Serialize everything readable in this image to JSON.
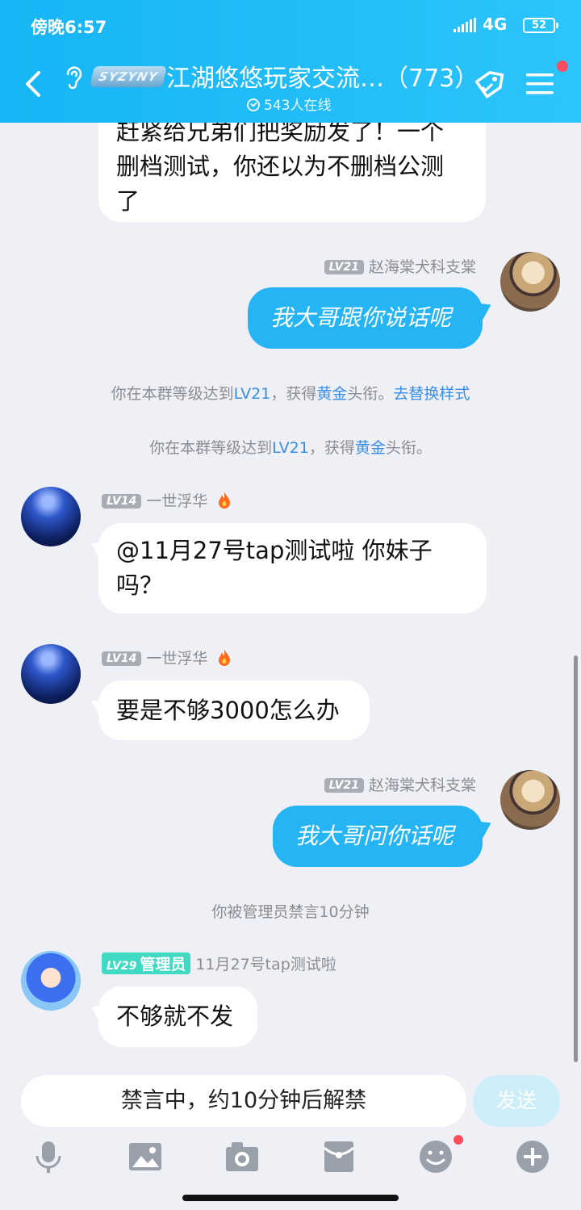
{
  "status_bar": {
    "time": "傍晚6:57",
    "network": "4G",
    "battery": "52"
  },
  "header": {
    "logo_text": "SYZYNY",
    "title": "江湖悠悠玩家交流…（773）",
    "online": "543人在线"
  },
  "messages": [
    {
      "type": "bubble-left-partial",
      "text_lines": [
        "赶紧给兄弟们把奖励发了！一个",
        "删档测试，你还以为不删档公测",
        "了"
      ]
    },
    {
      "type": "bubble-right",
      "level": "LV21",
      "name": "赵海棠犬科支棠",
      "text": "我大哥跟你说话呢"
    },
    {
      "type": "system",
      "text_a": "你在本群等级达到",
      "level": "LV21",
      "text_b": "，获得",
      "title": "黄金",
      "text_c": "头衔。",
      "link": "去替换样式"
    },
    {
      "type": "system",
      "text_a": "你在本群等级达到",
      "level": "LV21",
      "text_b": "，获得",
      "title": "黄金",
      "text_c": "头衔。"
    },
    {
      "type": "bubble-left",
      "level": "LV14",
      "name": "一世浮华",
      "text_lines": [
        "@11月27号tap测试啦 你妹子",
        "吗？"
      ]
    },
    {
      "type": "bubble-left",
      "level": "LV14",
      "name": "一世浮华",
      "text": "要是不够3000怎么办"
    },
    {
      "type": "bubble-right",
      "level": "LV21",
      "name": "赵海棠犬科支棠",
      "text": "我大哥问你话呢"
    },
    {
      "type": "system",
      "text": "你被管理员禁言10分钟"
    },
    {
      "type": "bubble-left",
      "level": "LV29",
      "role": "管理员",
      "name": "11月27号tap测试啦",
      "text": "不够就不发"
    }
  ],
  "input": {
    "placeholder": "禁言中，约10分钟后解禁",
    "send_label": "发送"
  },
  "toolbar": [
    "mic-icon",
    "image-icon",
    "camera-icon",
    "red-packet-icon",
    "emoji-icon",
    "plus-icon"
  ],
  "colors": {
    "header": "#1eb9f7",
    "bubble_self": "#25b5f5",
    "link": "#3a8ee6",
    "admin_badge": "#3fd9c4",
    "notify_dot": "#ff4d5e"
  }
}
